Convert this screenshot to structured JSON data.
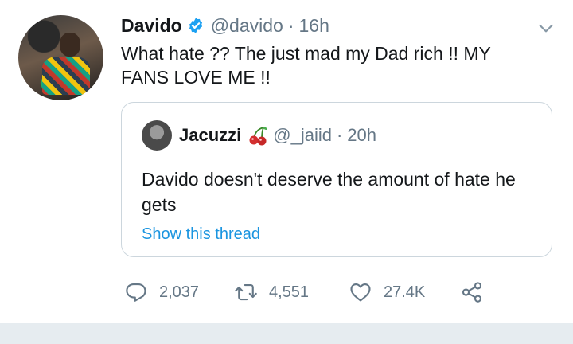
{
  "tweet": {
    "author_name": "Davido",
    "author_handle": "@davido",
    "separator": "·",
    "time": "16h",
    "text": "What hate ?? The just  mad my Dad rich !!  MY\nFANS LOVE ME !!"
  },
  "quoted": {
    "author_name": "Jacuzzi",
    "emoji": "cherries-icon",
    "author_handle": "@_jaiid",
    "separator": "·",
    "time": "20h",
    "text": "Davido doesn't deserve the amount of hate he gets",
    "link": "Show this thread"
  },
  "actions": {
    "replies": "2,037",
    "retweets": "4,551",
    "likes": "27.4K"
  },
  "colors": {
    "text": "#14171a",
    "secondary": "#657786",
    "link": "#1b95e0",
    "verified": "#1da1f2",
    "border": "#ccd6dd"
  }
}
